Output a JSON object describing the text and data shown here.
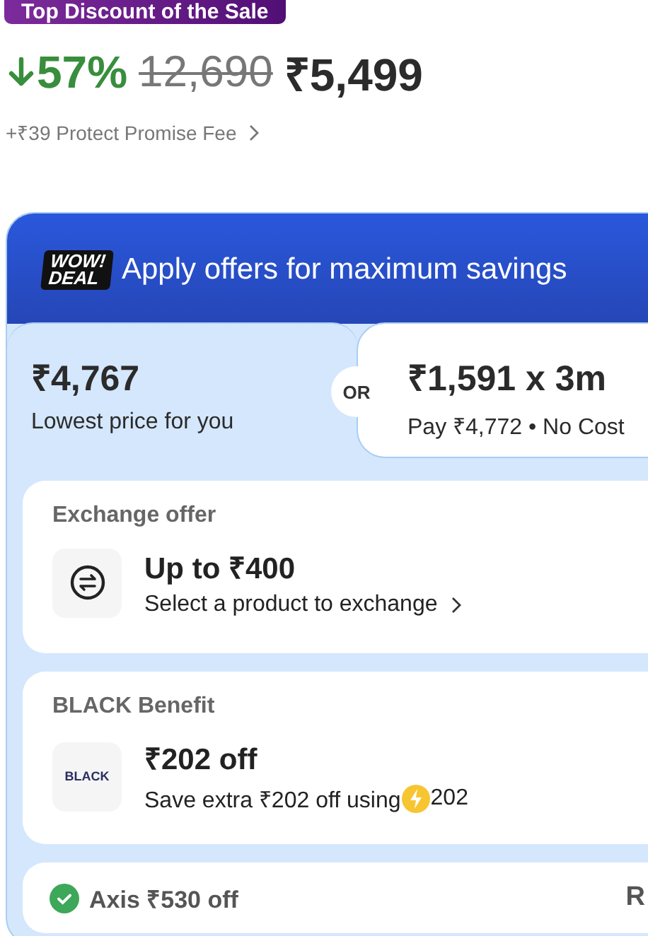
{
  "badge": "Top Discount of the Sale",
  "price": {
    "discount": "57%",
    "original": "12,690",
    "final": "₹5,499",
    "fee": "+₹39 Protect Promise Fee"
  },
  "offers_card": {
    "logo_top": "WOW!",
    "logo_bottom": "DEAL",
    "title": "Apply offers for maximum savings",
    "options": [
      {
        "amount": "₹4,767",
        "caption": "Lowest price for you",
        "selected": true
      },
      {
        "amount": "₹1,591 x 3m",
        "caption": "Pay ₹4,772 • No Cost",
        "selected": false
      }
    ],
    "separator": "OR",
    "offers": [
      {
        "kind": "exchange",
        "heading": "Exchange offer",
        "title": "Up to ₹400",
        "text": "Select a product to exchange",
        "link": true
      },
      {
        "kind": "black",
        "heading": "BLACK Benefit",
        "logo": "BLACK",
        "title": "₹202 off",
        "text": "Save extra ₹202 off using",
        "coin_amount": "202",
        "link": false
      },
      {
        "kind": "bank",
        "title": "Axis ₹530 off",
        "side": "R"
      }
    ]
  }
}
